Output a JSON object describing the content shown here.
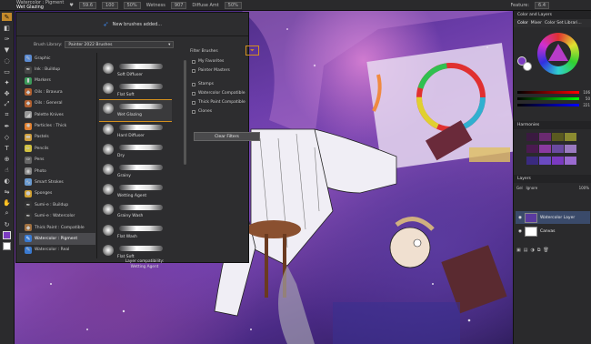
{
  "topbar": {
    "category": "Watercolor : Pigment",
    "variant": "Wet Glazing",
    "size_value": "59.6",
    "opacity_value": "100",
    "grain_value": "50%",
    "wetness_label": "Wetness",
    "wetness_value": "907",
    "diffuse_label": "Diffuse Amt",
    "diffuse_value": "50%",
    "feature_label": "Feature:",
    "feature_value": "6.4"
  },
  "library": {
    "header_text": "New brushes added...",
    "library_label": "Brush Library:",
    "library_value": "Painter 2022 Brushes",
    "categories": [
      {
        "label": "Graphic",
        "color": "#5b8ad0",
        "icon": "✎"
      },
      {
        "label": "Ink : Buildup",
        "color": "#444",
        "icon": "✒"
      },
      {
        "label": "Markers",
        "color": "#3c9a5a",
        "icon": "▮"
      },
      {
        "label": "Oils : Bravura",
        "color": "#b06030",
        "icon": "◆"
      },
      {
        "label": "Oils : General",
        "color": "#b06030",
        "icon": "◆"
      },
      {
        "label": "Palette Knives",
        "color": "#999",
        "icon": "◢"
      },
      {
        "label": "Particles : Thick",
        "color": "#e08030",
        "icon": "✺"
      },
      {
        "label": "Pastels",
        "color": "#d0a040",
        "icon": "▬"
      },
      {
        "label": "Pencils",
        "color": "#d0c040",
        "icon": "✏"
      },
      {
        "label": "Pens",
        "color": "#666",
        "icon": "✑"
      },
      {
        "label": "Photo",
        "color": "#888",
        "icon": "◉"
      },
      {
        "label": "Smart Strokes",
        "color": "#6a9ad0",
        "icon": "∿"
      },
      {
        "label": "Sponges",
        "color": "#d0a030",
        "icon": "●"
      },
      {
        "label": "Sumi-e : Buildup",
        "color": "#333",
        "icon": "✒"
      },
      {
        "label": "Sumi-e : Watercolor",
        "color": "#333",
        "icon": "✒"
      },
      {
        "label": "Thick Paint : Compatible",
        "color": "#a07040",
        "icon": "◆"
      },
      {
        "label": "Watercolor : Pigment",
        "color": "#3a7ad0",
        "icon": "✎"
      },
      {
        "label": "Watercolor : Real",
        "color": "#3a7ad0",
        "icon": "✎"
      }
    ],
    "selected_category": "Watercolor : Pigment",
    "variants": [
      "Soft Diffuser",
      "Flat Soft",
      "Wet Glazing",
      "Hard Diffuser",
      "Dry",
      "Grainy",
      "Wetting Agent",
      "Grainy Wash",
      "Flat Wash",
      "Flat Soft"
    ],
    "selected_variant": "Wet Glazing",
    "compat_line1": "Layer compatibility:",
    "compat_line2": "Wetting Agent"
  },
  "filter": {
    "title": "Filter Brushes",
    "options": [
      "My Favorites",
      "Painter Masters",
      "Stamps",
      "Watercolor Compatible",
      "Thick Paint Compatible",
      "Clones"
    ],
    "clear_label": "Clear Filters"
  },
  "color_panel": {
    "title": "Color and Layers",
    "tab_color": "Color",
    "tab_mixer": "Mixer",
    "tab_sets": "Color Set Librari...",
    "main_color": "#7c3cc0",
    "slider_values": [
      "106",
      "50",
      "221"
    ]
  },
  "harmonies": {
    "title": "Harmonies",
    "rows": [
      [
        "#3a1a40",
        "#6a2a70",
        "#5a5a20",
        "#8a8a30"
      ],
      [
        "#4a1a50",
        "#8a3aa0",
        "#6a4aa0",
        "#9a7ac0"
      ],
      [
        "#3a2a80",
        "#6a4ac0",
        "#7a3ac0",
        "#9a6ad0"
      ]
    ]
  },
  "layers": {
    "title": "Layers",
    "composite_label": "Gel",
    "ignore_label": "Ignore",
    "opacity_value": "100%",
    "items": [
      "Watercolor Layer",
      "Canvas"
    ]
  }
}
